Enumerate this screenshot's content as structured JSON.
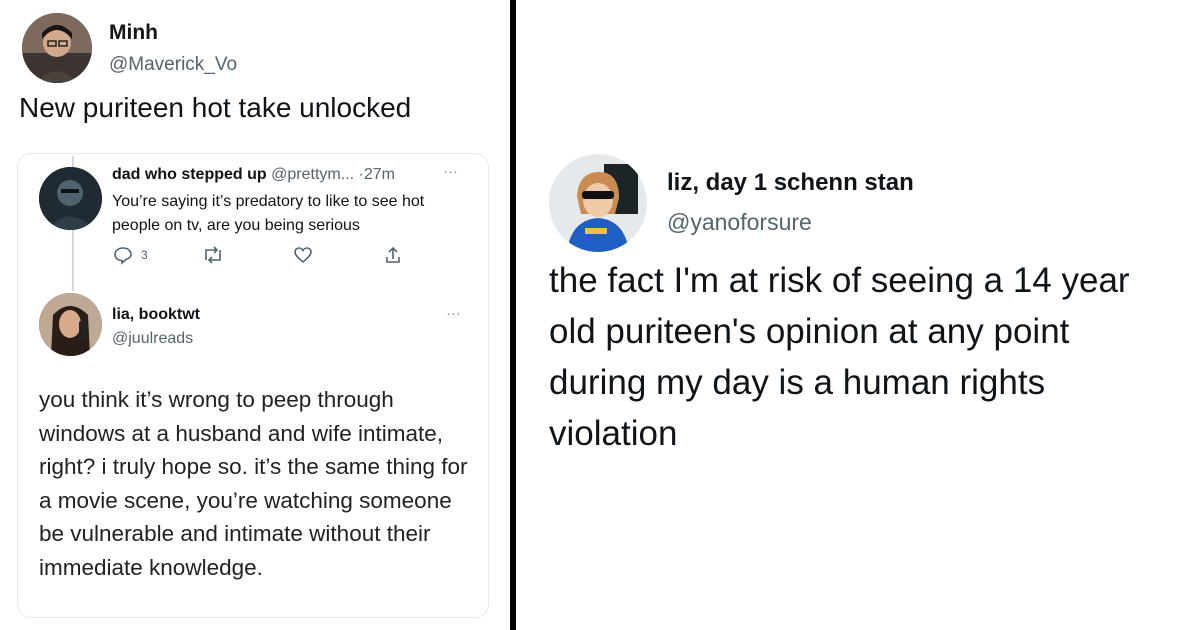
{
  "left": {
    "main_tweet": {
      "display_name": "Minh",
      "handle": "@Maverick_Vo",
      "text": "New puriteen hot take unlocked"
    },
    "quoted_thread": {
      "first_reply": {
        "display_name": "dad who stepped up",
        "handle_truncated": "@prettym...",
        "separator": "·",
        "time": "27m",
        "more": "···",
        "text": "You’re saying it’s predatory to like to see hot people on tv, are you being serious",
        "reply_count": "3"
      },
      "second_reply": {
        "display_name": "lia, booktwt",
        "handle": "@juulreads",
        "more": "···",
        "text": "you think it’s wrong to peep through windows at a husband and wife intimate, right? i truly hope so. it’s the same thing for a movie scene, you’re watching someone be vulnerable and intimate without their immediate knowledge."
      }
    }
  },
  "right": {
    "display_name": "liz, day 1 schenn stan",
    "handle": "@yanoforsure",
    "text": "the fact I'm at risk of seeing a 14 year old puriteen's opinion at any point during my day is a human rights violation"
  },
  "icons": [
    "reply-icon",
    "retweet-icon",
    "like-icon",
    "share-icon",
    "more-icon"
  ],
  "colors": {
    "secondary_text": "#536471",
    "divider": "#000000",
    "text": "#0f1419"
  }
}
